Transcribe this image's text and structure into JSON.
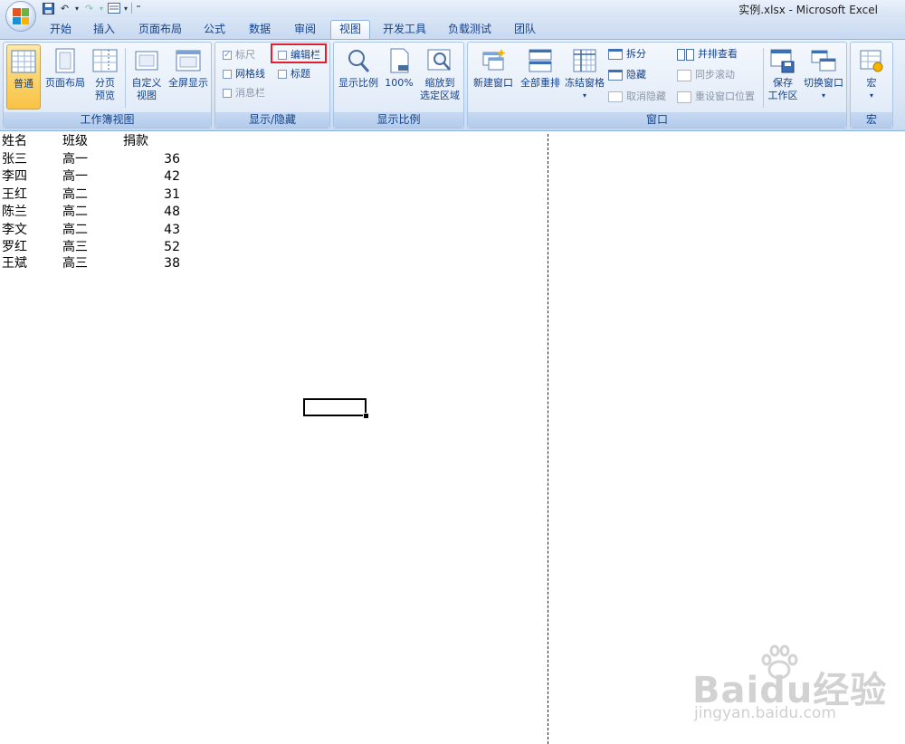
{
  "window": {
    "title": "实例.xlsx - Microsoft Excel",
    "qat_icons": [
      "save-icon",
      "undo-icon",
      "redo-icon",
      "form-icon",
      "customize-qat-icon"
    ]
  },
  "tabs": [
    "开始",
    "插入",
    "页面布局",
    "公式",
    "数据",
    "审阅",
    "视图",
    "开发工具",
    "负载测试",
    "团队"
  ],
  "active_tab": "视图",
  "ribbon": {
    "workbook_views": {
      "label": "工作簿视图",
      "normal": "普通",
      "page_layout": "页面布局",
      "page_break_1": "分页",
      "page_break_2": "预览",
      "custom_1": "自定义",
      "custom_2": "视图",
      "full_screen": "全屏显示"
    },
    "show_hide": {
      "label": "显示/隐藏",
      "ruler": "标尺",
      "gridlines": "网格线",
      "message_bar": "消息栏",
      "formula_bar": "编辑栏",
      "headings": "标题"
    },
    "zoom": {
      "label": "显示比例",
      "zoom": "显示比例",
      "hundred": "100%",
      "zoom_sel_1": "缩放到",
      "zoom_sel_2": "选定区域"
    },
    "window": {
      "label": "窗口",
      "new_window": "新建窗口",
      "arrange_all": "全部重排",
      "freeze_panes": "冻结窗格",
      "split": "拆分",
      "hide": "隐藏",
      "unhide": "取消隐藏",
      "side_by_side": "并排查看",
      "sync_scroll": "同步滚动",
      "reset_pos": "重设窗口位置",
      "save_ws_1": "保存",
      "save_ws_2": "工作区",
      "switch_windows": "切换窗口"
    },
    "macros": {
      "label": "宏",
      "macros": "宏"
    }
  },
  "sheet": {
    "headers": [
      "姓名",
      "班级",
      "捐款"
    ],
    "rows": [
      [
        "张三",
        "高一",
        "36"
      ],
      [
        "李四",
        "高一",
        "42"
      ],
      [
        "王红",
        "高二",
        "31"
      ],
      [
        "陈兰",
        "高二",
        "48"
      ],
      [
        "李文",
        "高二",
        "43"
      ],
      [
        "罗红",
        "高三",
        "52"
      ],
      [
        "王斌",
        "高三",
        "38"
      ]
    ]
  },
  "watermark": {
    "main": "Baidu经验",
    "sub": "jingyan.baidu.com"
  }
}
